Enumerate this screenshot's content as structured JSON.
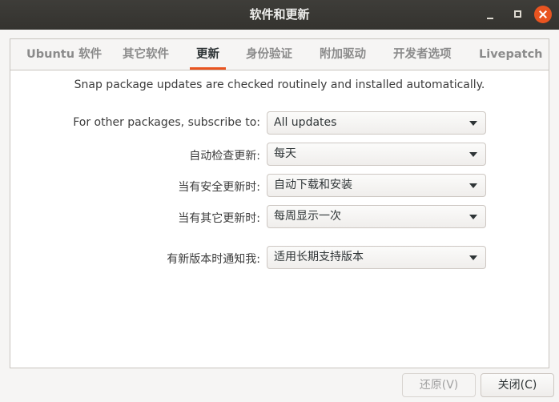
{
  "window": {
    "title": "软件和更新"
  },
  "tabs": [
    {
      "label": "Ubuntu 软件",
      "active": false
    },
    {
      "label": "其它软件",
      "active": false
    },
    {
      "label": "更新",
      "active": true
    },
    {
      "label": "身份验证",
      "active": false
    },
    {
      "label": "附加驱动",
      "active": false
    },
    {
      "label": "开发者选项",
      "active": false
    },
    {
      "label": "Livepatch",
      "active": false
    }
  ],
  "updates": {
    "snap_info": "Snap package updates are checked routinely and installed automatically.",
    "settings": [
      {
        "label": "For other packages, subscribe to:",
        "value": "All updates"
      },
      {
        "label": "自动检查更新:",
        "value": "每天"
      },
      {
        "label": "当有安全更新时:",
        "value": "自动下载和安装"
      },
      {
        "label": "当有其它更新时:",
        "value": "每周显示一次"
      },
      {
        "label": "有新版本时通知我:",
        "value": "适用长期支持版本"
      }
    ]
  },
  "buttons": {
    "revert": "还原(V)",
    "close": "关闭(C)"
  },
  "colors": {
    "accent": "#e95420",
    "titlebar": "#3c3b37"
  },
  "icons": {
    "minimize": "minimize-icon",
    "maximize": "maximize-icon",
    "close": "close-icon",
    "dropdown": "chevron-down-icon"
  }
}
